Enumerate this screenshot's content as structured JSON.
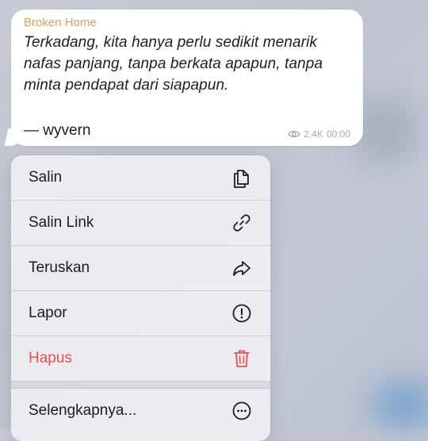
{
  "message": {
    "sender": "Broken Home",
    "text": "Terkadang, kita hanya perlu sedikit menarik nafas panjang, tanpa berkata apapun, tanpa minta pendapat dari siapapun.",
    "author": "— wyvern",
    "views": "2,4K",
    "time": "00:00"
  },
  "menu": {
    "items": [
      {
        "label": "Salin",
        "icon": "copy-icon"
      },
      {
        "label": "Salin Link",
        "icon": "link-icon"
      },
      {
        "label": "Teruskan",
        "icon": "forward-icon"
      },
      {
        "label": "Lapor",
        "icon": "report-icon"
      },
      {
        "label": "Hapus",
        "icon": "trash-icon",
        "color": "#e5504a"
      },
      {
        "label": "Selengkapnya...",
        "icon": "more-icon"
      }
    ]
  }
}
